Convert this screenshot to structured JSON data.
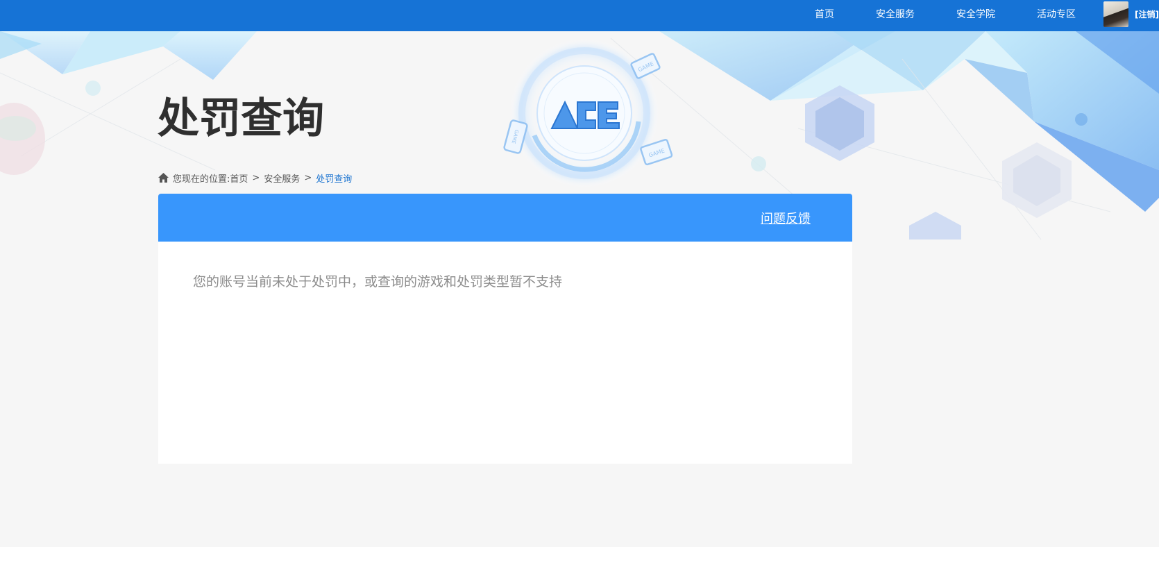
{
  "nav": {
    "items": [
      {
        "label": "首页"
      },
      {
        "label": "安全服务"
      },
      {
        "label": "安全学院"
      },
      {
        "label": "活动专区"
      }
    ],
    "logout_label": "[注销]"
  },
  "page": {
    "title": "处罚查询"
  },
  "breadcrumb": {
    "prefix": "您现在的位置:",
    "items": [
      "首页",
      "安全服务",
      "处罚查询"
    ],
    "separator": ">"
  },
  "panel": {
    "feedback_label": "问题反馈",
    "message": "您的账号当前未处于处罚中，或查询的游戏和处罚类型暂不支持"
  },
  "banner": {
    "logo_text": "ACE",
    "device_label": "GAME"
  },
  "colors": {
    "topbar": "#1673d6",
    "panel_header": "#3896fc",
    "breadcrumb_current": "#1a73d0",
    "page_background": "#f6f6f6"
  }
}
